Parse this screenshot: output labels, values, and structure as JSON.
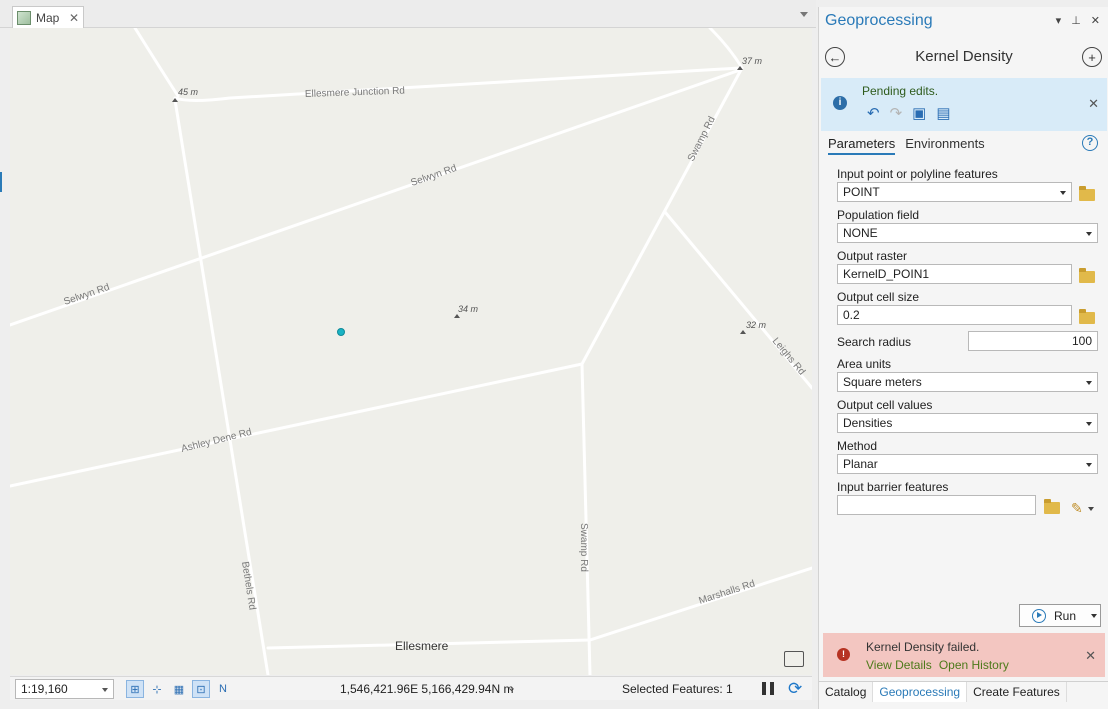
{
  "map": {
    "tab_title": "Map",
    "labels": {
      "ellesmere_junction_rd": "Ellesmere Junction Rd",
      "selwyn_rd_1": "Selwyn Rd",
      "selwyn_rd_2": "Selwyn Rd",
      "swamp_rd_1": "Swamp Rd",
      "swamp_rd_2": "Swamp Rd",
      "leighs_rd": "Leighs Rd",
      "ashley_dene_rd": "Ashley Dene Rd",
      "bethels_rd": "Bethels Rd",
      "marshalls_rd": "Marshalls Rd",
      "ellesmere": "Ellesmere",
      "elev_45": "45 m",
      "elev_37": "37 m",
      "elev_34": "34 m",
      "elev_32": "32 m"
    },
    "point_color": "#19b3c4"
  },
  "statusbar": {
    "scale": "1:19,160",
    "coordinates": "1,546,421.96E 5,166,429.94N m",
    "selected_features": "Selected Features: 1"
  },
  "gp": {
    "pane_title": "Geoprocessing",
    "tool_name": "Kernel Density",
    "pending_message": "Pending edits.",
    "tabs": [
      "Parameters",
      "Environments"
    ],
    "params": {
      "input_label": "Input point or polyline features",
      "input_value": "POINT",
      "population_label": "Population field",
      "population_value": "NONE",
      "output_raster_label": "Output raster",
      "output_raster_value": "KernelD_POIN1",
      "cell_size_label": "Output cell size",
      "cell_size_value": "0.2",
      "search_radius_label": "Search radius",
      "search_radius_value": "100",
      "area_units_label": "Area units",
      "area_units_value": "Square meters",
      "cell_values_label": "Output cell values",
      "cell_values_value": "Densities",
      "method_label": "Method",
      "method_value": "Planar",
      "barrier_label": "Input barrier features",
      "barrier_value": ""
    },
    "run_label": "Run",
    "error": {
      "message": "Kernel Density failed.",
      "view_details": "View Details",
      "open_history": "Open History"
    },
    "bottom_tabs": [
      "Catalog",
      "Geoprocessing",
      "Create Features"
    ]
  }
}
